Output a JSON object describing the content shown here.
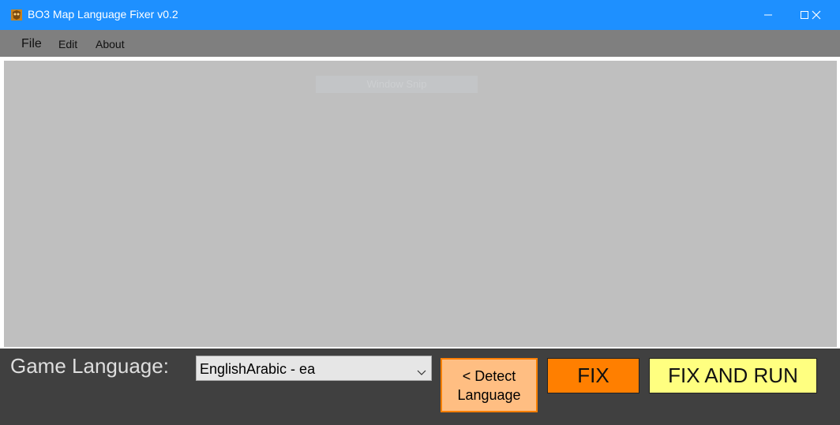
{
  "window": {
    "title": "BO3 Map Language Fixer v0.2",
    "icon": "app-icon",
    "titlebar_color": "#1e90ff",
    "controls": [
      "minimize-icon",
      "maximize-icon",
      "close-icon"
    ]
  },
  "menu": {
    "items": [
      {
        "label": "File"
      },
      {
        "label": "Edit"
      },
      {
        "label": "About"
      }
    ]
  },
  "content": {
    "ghost_label": "Window Snip"
  },
  "language": {
    "label": "Game Language:",
    "selected": "EnglishArabic - ea"
  },
  "buttons": {
    "detect_line1": "< Detect",
    "detect_line2": "Language",
    "fix": "FIX",
    "fix_and_run": "FIX AND RUN"
  },
  "colors": {
    "detect_bg": "#ffbe82",
    "detect_border": "#ff7f00",
    "fix_bg": "#ff7f00",
    "fix_and_run_bg": "#ffff80",
    "content_bg": "#bfbfbf",
    "bottom_bg": "#404040"
  }
}
